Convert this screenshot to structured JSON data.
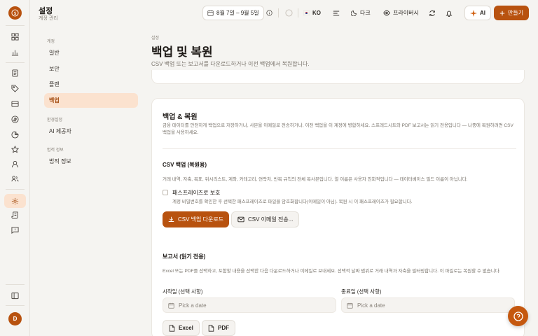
{
  "app": {
    "title": "설정",
    "subtitle": "계정 관리"
  },
  "topbar": {
    "date_range": "8월 7일 – 9월 5일",
    "language": "KO",
    "theme_label": "다크",
    "privacy_label": "프라이버시",
    "ai_label": "AI",
    "create_label": "만들기"
  },
  "user": {
    "initial": "D"
  },
  "subnav": {
    "group_account": "계정",
    "items_account": [
      "일반",
      "보안",
      "플랜",
      "백업"
    ],
    "group_env": "환경설정",
    "items_env": [
      "AI 제공자"
    ],
    "group_legal": "법적 정보",
    "items_legal": [
      "법적 정보"
    ],
    "active": "백업"
  },
  "page": {
    "breadcrumb": "설정",
    "title": "백업 및 복원",
    "description": "CSV 백업 또는 보고서를 다운로드하거나 이전 백업에서 복원합니다."
  },
  "card": {
    "title": "백업 & 복원",
    "description": "금융 데이터를 안전하게 백업으로 저장하거나, 사본을 이메일로 전송하거나, 이전 백업을 이 계정에 병합하세요. 스프레드시트와 PDF 보고서는 읽기 전용입니다 — 나중에 복원하려면 CSV 백업을 사용하세요.",
    "csv": {
      "title": "CSV 백업 (복원용)",
      "description": "거래 내역, 자축, 목표, 위시리스트, 계좌, 카테고리, 연락처, 반복 규칙의 전체 복사본입니다. 열 이름은 사용자 친화적입니다 — 데이터베이스 필드 이름이 아닙니다.",
      "passphrase_label": "패스프레이즈로 보호",
      "passphrase_desc": "계정 비밀번호를 확인한 후 선택한 패스프레이즈로 파일을 암호화합니다(이메일이 아님). 복원 시 이 패스프레이즈가 필요합니다.",
      "download_label": "CSV 백업 다운로드",
      "email_label": "CSV 이메일 전송..."
    },
    "report": {
      "title": "보고서 (읽기 전용)",
      "description": "Excel 또는 PDF를 선택하고, 포함할 내용을 선택한 다음 다운로드하거나 이메일로 보내세요. 선택적 날짜 범위로 거래 내역과 자축을 필터링합니다. 이 파일로는 복원할 수 없습니다.",
      "start_label": "시작일 (선택 사항)",
      "end_label": "종료일 (선택 사항)",
      "date_placeholder": "Pick a date",
      "excel_label": "Excel",
      "pdf_label": "PDF"
    }
  },
  "colors": {
    "accent": "#b8520f",
    "accent_soft": "#fbe2cf",
    "background": "#f5f4f1"
  }
}
